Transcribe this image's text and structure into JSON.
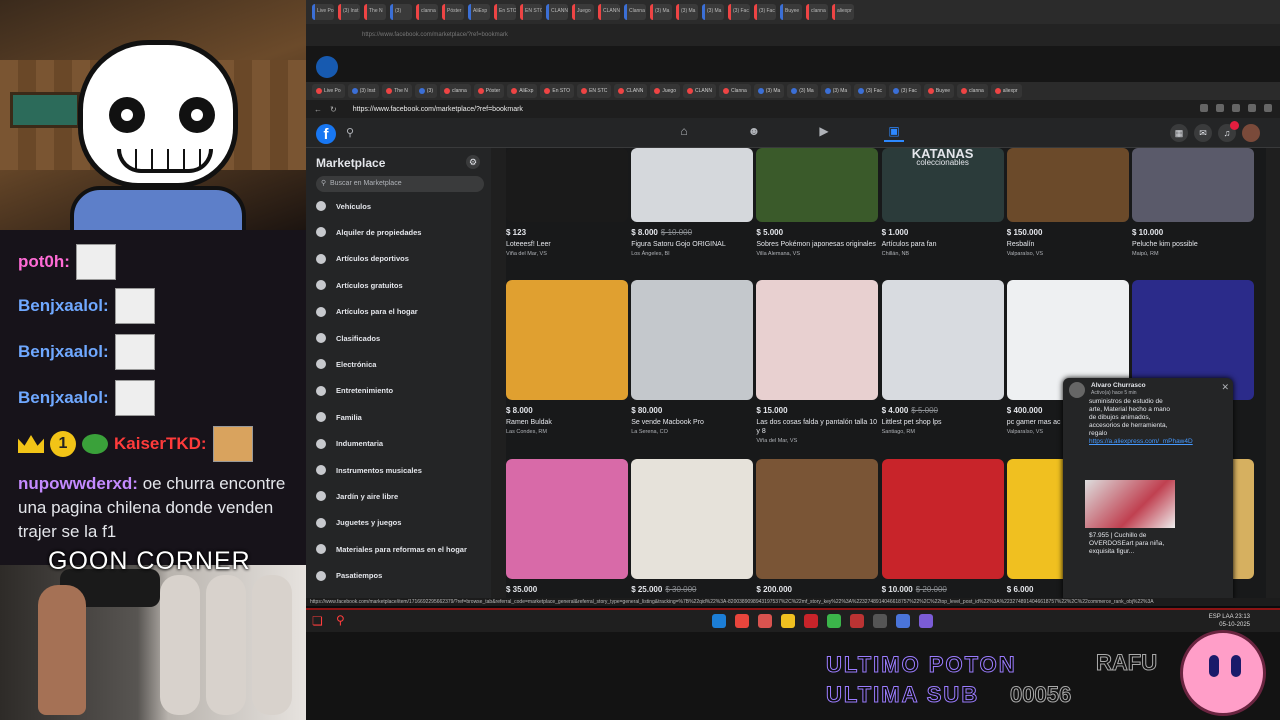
{
  "stream": {
    "chat": [
      {
        "user": "pot0h:",
        "color": "#ff6bd6"
      },
      {
        "user": "Benjxaalol:",
        "color": "#6fa8ff"
      },
      {
        "user": "Benjxaalol:",
        "color": "#6fa8ff"
      },
      {
        "user": "Benjxaalol:",
        "color": "#6fa8ff"
      },
      {
        "user": "KaiserTKD:",
        "badge_number": "1",
        "color": "#ff3b3b"
      }
    ],
    "last_message": {
      "user": "nupowwderxd:",
      "text": "oe churra encontre una pagina chilena donde venden trajer se la f1"
    },
    "overlay_title": "GOON CORNER",
    "ultimo_poton": "ULTIMO POTON",
    "ultima_sub": "ULTIMA SUB",
    "sub_counter": "00056",
    "rafu": "RAFU"
  },
  "browser": {
    "url_ghost": "https://www.facebook.com/marketplace/?ref=bookmark",
    "url": "https://www.facebook.com/marketplace/?ref=bookmark",
    "tabs": [
      "Live Po",
      "(3) Inst",
      "The N",
      "(3)",
      "clanna",
      "Póster",
      "AliExp",
      "En STO",
      "EN STC",
      "CLANN",
      "Juego",
      "CLANN",
      "Clanna",
      "(3) Ma",
      "(3) Ma",
      "(3) Ma",
      "(3) Fac",
      "(3) Fac",
      "Buyee",
      "clanna",
      "aliexpr"
    ],
    "status_url": "https://www.facebook.com/marketplace/item/1716692295662379/?ref=browse_tab&referral_code=marketplace_general&referral_story_type=general_listing&tracking=%7B%22qid%22%3A-8200389098943197537%2C%22mf_story_key%22%3A%2232748914046618757%22%2C%22top_level_post_id%22%3A%2232748914046618757%22%2C%22commerce_rank_obj%22%3A"
  },
  "marketplace": {
    "title": "Marketplace",
    "search_placeholder": "Buscar en Marketplace",
    "categories": [
      "Vehículos",
      "Alquiler de propiedades",
      "Artículos deportivos",
      "Artículos gratuitos",
      "Artículos para el hogar",
      "Clasificados",
      "Electrónica",
      "Entretenimiento",
      "Familia",
      "Indumentaria",
      "Instrumentos musicales",
      "Jardín y aire libre",
      "Juguetes y juegos",
      "Materiales para reformas en el hogar",
      "Pasatiempos"
    ],
    "listings_row1": [
      {
        "price": "$ 123",
        "old_price": "",
        "title": "Loteeesf! Leer",
        "location": "Viña del Mar, VS",
        "color": "#1a1a1a"
      },
      {
        "price": "$ 8.000",
        "old_price": "$ 10.000",
        "title": "Figura Satoru Gojo ORIGINAL",
        "location": "Los Ángeles, BI",
        "color": "#d5d8dc"
      },
      {
        "price": "$ 5.000",
        "old_price": "",
        "title": "Sobres Pokémon japonesas originales",
        "location": "Villa Alemana, VS",
        "color": "#3a5a2a"
      },
      {
        "price": "$ 1.000",
        "old_price": "",
        "title": "Artículos para fan",
        "location": "Chillán, NB",
        "color": "#2b3b3a"
      },
      {
        "price": "$ 150.000",
        "old_price": "",
        "title": "Resbalín",
        "location": "Valparaíso, VS",
        "color": "#6b4a2a"
      },
      {
        "price": "$ 10.000",
        "old_price": "",
        "title": "Peluche kim possible",
        "location": "Maipú, RM",
        "color": "#5a5a6a"
      }
    ],
    "listings_row2": [
      {
        "price": "$ 8.000",
        "old_price": "",
        "title": "Ramen Buldak",
        "location": "Las Condes, RM",
        "color": "#e0a030"
      },
      {
        "price": "$ 80.000",
        "old_price": "",
        "title": "Se vende Macbook Pro",
        "location": "La Serena, CO",
        "color": "#c4c8cc"
      },
      {
        "price": "$ 15.000",
        "old_price": "",
        "title": "Las dos cosas falda y pantalón talla 10 y 8",
        "location": "Viña del Mar, VS",
        "color": "#e8d0d0"
      },
      {
        "price": "$ 4.000",
        "old_price": "$ 5.000",
        "title": "Littlest pet shop lps",
        "location": "Santiago, RM",
        "color": "#d8dbe0"
      },
      {
        "price": "$ 400.000",
        "old_price": "",
        "title": "pc gamer mas ac",
        "location": "Valparaíso, VS",
        "color": "#eef0f2"
      },
      {
        "price": "",
        "old_price": "",
        "title": "",
        "location": "",
        "color": "#2b2b8a"
      }
    ],
    "listings_row3": [
      {
        "price": "$ 35.000",
        "old_price": "",
        "color": "#d86aa8"
      },
      {
        "price": "$ 25.000",
        "old_price": "$ 30.000",
        "color": "#e6e2da"
      },
      {
        "price": "$ 200.000",
        "old_price": "",
        "color": "#7a5536"
      },
      {
        "price": "$ 10.000",
        "old_price": "$ 20.000",
        "color": "#c8242a"
      },
      {
        "price": "$ 6.000",
        "old_price": "",
        "color": "#f0c020"
      },
      {
        "price": "",
        "old_price": "",
        "color": "#d6b060"
      }
    ],
    "row1_extra_title": "KATANAS",
    "row1_extra_subtitle": "coleccionables"
  },
  "messenger": {
    "name": "Alvaro Churrasco",
    "status": "Activo(a) hace 5 min",
    "message": "suministros de estudio de arte, Material hecho a mano de dibujos animados, accesorios de herramienta, regalo",
    "link": "https://a.aliexpress.com/_mPhaw4D",
    "caption": "$7.955 | Cuchillo de OVERDOSEart para niña, exquisita figur..."
  },
  "taskbar": {
    "lang": "ESP LAA",
    "time": "23:13",
    "date": "05-10-2025"
  }
}
